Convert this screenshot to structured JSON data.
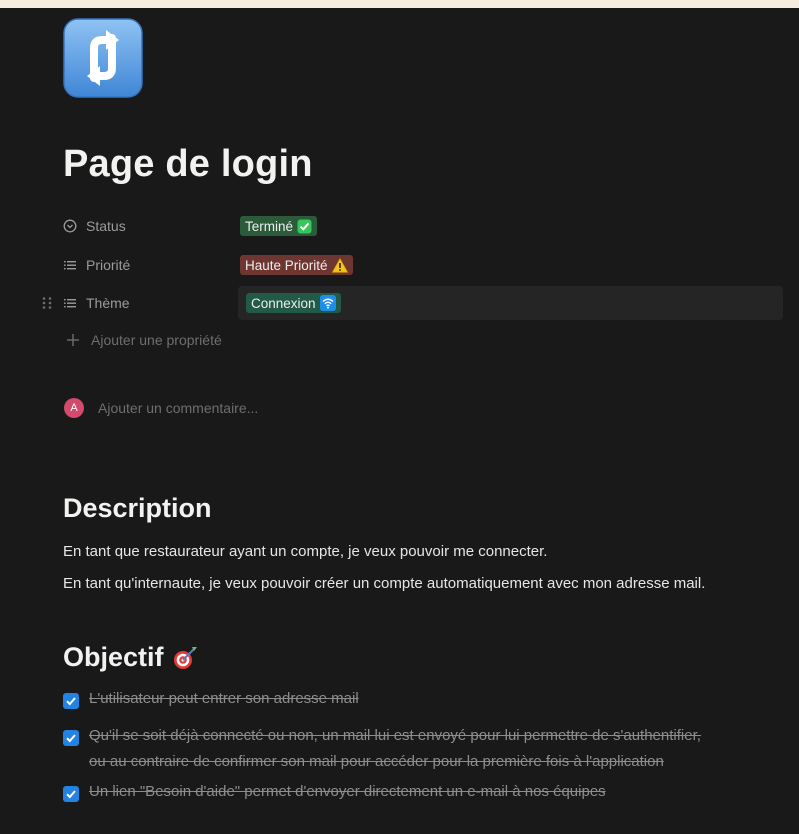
{
  "page": {
    "icon": "repeat-arrows-icon",
    "title": "Page de login"
  },
  "properties": [
    {
      "label": "Status",
      "icon": "status-circle-icon",
      "value": "Terminé",
      "emoji": "check-mark-button-icon",
      "color": "#2b5b3a"
    },
    {
      "label": "Priorité",
      "icon": "list-icon",
      "value": "Haute Priorité",
      "emoji": "warning-icon",
      "color": "#6e3630"
    },
    {
      "label": "Thème",
      "icon": "list-icon",
      "value": "Connexion",
      "emoji": "wifi-icon",
      "color": "#235a47"
    }
  ],
  "add_property_label": "Ajouter une propriété",
  "comment": {
    "avatar_initial": "A",
    "placeholder": "Ajouter un commentaire..."
  },
  "description": {
    "heading": "Description",
    "paragraphs": [
      "En tant que restaurateur ayant un compte, je veux pouvoir me connecter.",
      "En tant qu'internaute, je veux pouvoir créer un compte automatiquement avec mon adresse mail."
    ]
  },
  "objectif": {
    "heading": "Objectif",
    "heading_icon": "target-dart-icon",
    "todos": [
      {
        "checked": true,
        "text": "L'utilisateur peut entrer son adresse mail"
      },
      {
        "checked": true,
        "line1": "Qu'il se soit déjà connecté ou non, un mail lui est envoyé pour lui permettre de s'authentifier,",
        "line2": "ou au contraire de confirmer son mail pour accéder pour la première fois à l'application"
      },
      {
        "checked": true,
        "text": "Un lien \"Besoin d'aide\" permet d'envoyer directement un e-mail à nos équipes"
      }
    ]
  },
  "colors": {
    "background": "#191919",
    "checkbox": "#2383e2",
    "avatar": "#d34a6c"
  }
}
